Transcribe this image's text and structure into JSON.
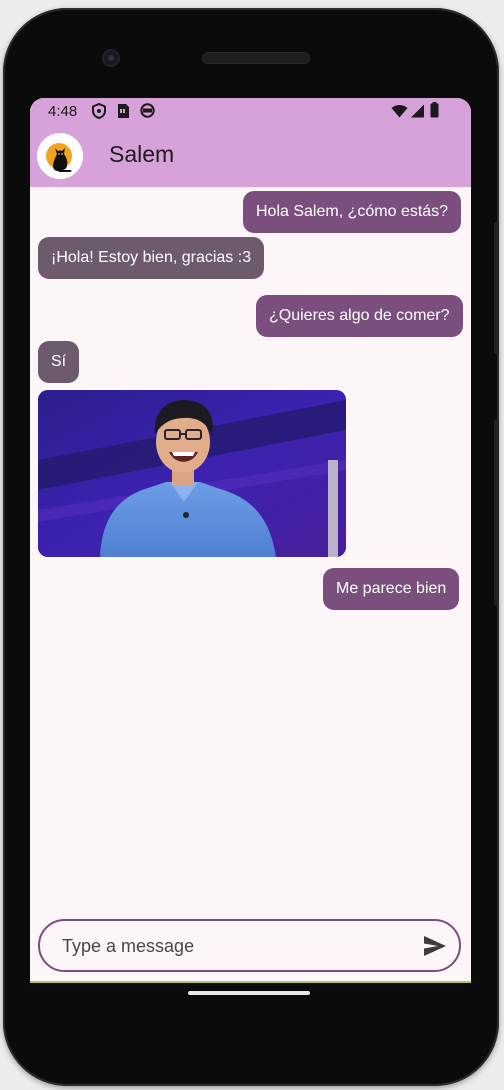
{
  "status_bar": {
    "time": "4:48",
    "icons": [
      "shield-icon",
      "sim-card-icon",
      "circle-app-icon",
      "wifi-icon",
      "cell-signal-icon",
      "battery-icon"
    ]
  },
  "app_bar": {
    "title": "Salem",
    "avatar": "black-cat-avatar"
  },
  "messages": [
    {
      "sender": "me",
      "text": "Hola Salem, ¿cómo estás?"
    },
    {
      "sender": "other",
      "text": "¡Hola! Estoy bien, gracias :3"
    },
    {
      "sender": "me",
      "text": "¿Quieres algo de comer?"
    },
    {
      "sender": "other",
      "text": "Sí"
    },
    {
      "sender": "other",
      "type": "gif",
      "content": "laughing-man-gif"
    },
    {
      "sender": "me",
      "text": "Me parece bien"
    }
  ],
  "input": {
    "placeholder": "Type a message",
    "value": ""
  },
  "colors": {
    "app_bar": "#d6a2d9",
    "sent_bubble": "#7a4f7e",
    "received_bubble": "#6d5b6d",
    "background": "#fdf6f8"
  }
}
